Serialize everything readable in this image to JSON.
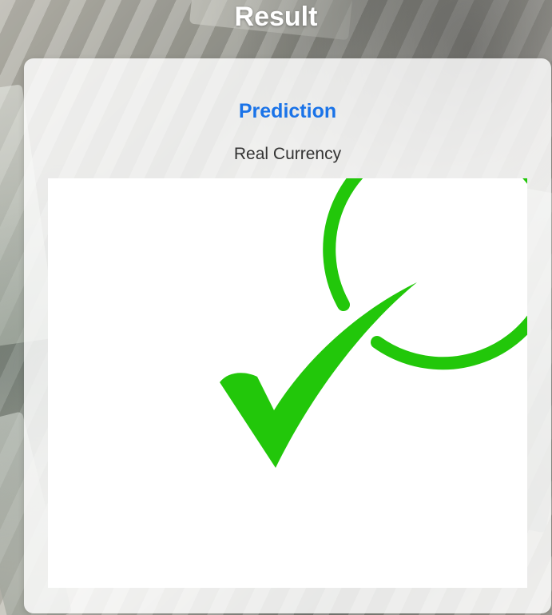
{
  "header": {
    "title": "Result"
  },
  "card": {
    "prediction_label": "Prediction",
    "prediction_value": "Real Currency",
    "result_icon": "check-circle-icon",
    "icon_color": "#22c70a"
  },
  "colors": {
    "title_text": "#ffffff",
    "prediction_label": "#1a73e8",
    "prediction_value": "#333333"
  }
}
